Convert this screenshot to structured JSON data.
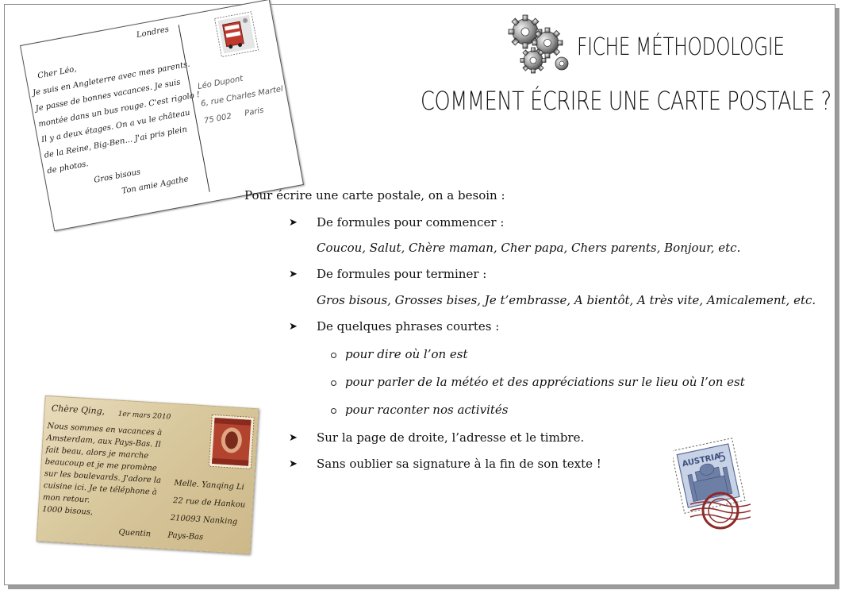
{
  "header": {
    "title_line1": "FICHE MÉTHODOLOGIE",
    "title_line2": "COMMENT ÉCRIRE UNE CARTE POSTALE ?"
  },
  "content": {
    "intro": "Pour écrire une carte postale, on a besoin :",
    "bullet_symbol": "➤",
    "item1": "De formules pour commencer :",
    "item1_examples": "Coucou, Salut, Chère maman, Cher papa, Chers parents, Bonjour, etc.",
    "item2": "De formules pour terminer :",
    "item2_examples": "Gros bisous, Grosses bises, Je t’embrasse, A bientôt, A très vite, Amicalement, etc.",
    "item3": "De quelques phrases courtes :",
    "item3_sub": [
      "pour dire où l’on est",
      "pour parler de la météo et des appréciations sur le lieu où l’on est",
      "pour raconter nos activités"
    ],
    "item4": "Sur la page de droite, l’adresse et le timbre.",
    "item5": "Sans oublier sa signature à la fin de son texte !"
  },
  "postcard1": {
    "place": "Londres",
    "lines": [
      "Cher Léo,",
      "Je suis en Angleterre avec mes parents.",
      "Je passe de bonnes vacances. Je suis",
      "montée dans un bus rouge. C'est rigolo !",
      "Il y a deux étages. On a vu le château",
      "de la Reine, Big-Ben... J'ai pris plein",
      "de photos."
    ],
    "closing": "Gros bisous",
    "signature": "Ton amie Agathe",
    "address": [
      "Léo Dupont",
      "6, rue Charles Martel",
      "75 002",
      "Paris"
    ]
  },
  "postcard2": {
    "greeting": "Chère Qing,",
    "date": "1er mars 2010",
    "lines": [
      "Nous sommes en vacances à",
      "Amsterdam, aux Pays-Bas. Il",
      "fait beau, alors je marche",
      "beaucoup et je me promène",
      "sur les boulevards. J'adore la",
      "cuisine ici. Je te téléphone à",
      "mon retour.",
      "1000 bisous,"
    ],
    "signature": "Quentin",
    "address": [
      "Melle. Yanqing Li",
      "22 rue de Hankou",
      "210093 Nanking",
      "Pays-Bas"
    ]
  },
  "stamp": {
    "country": "AUSTRIA",
    "value": "5"
  },
  "colors": {
    "stamp_blue": "#5c6f97",
    "postmark_red": "#8e2a2a",
    "paper": "#d8c89d"
  }
}
